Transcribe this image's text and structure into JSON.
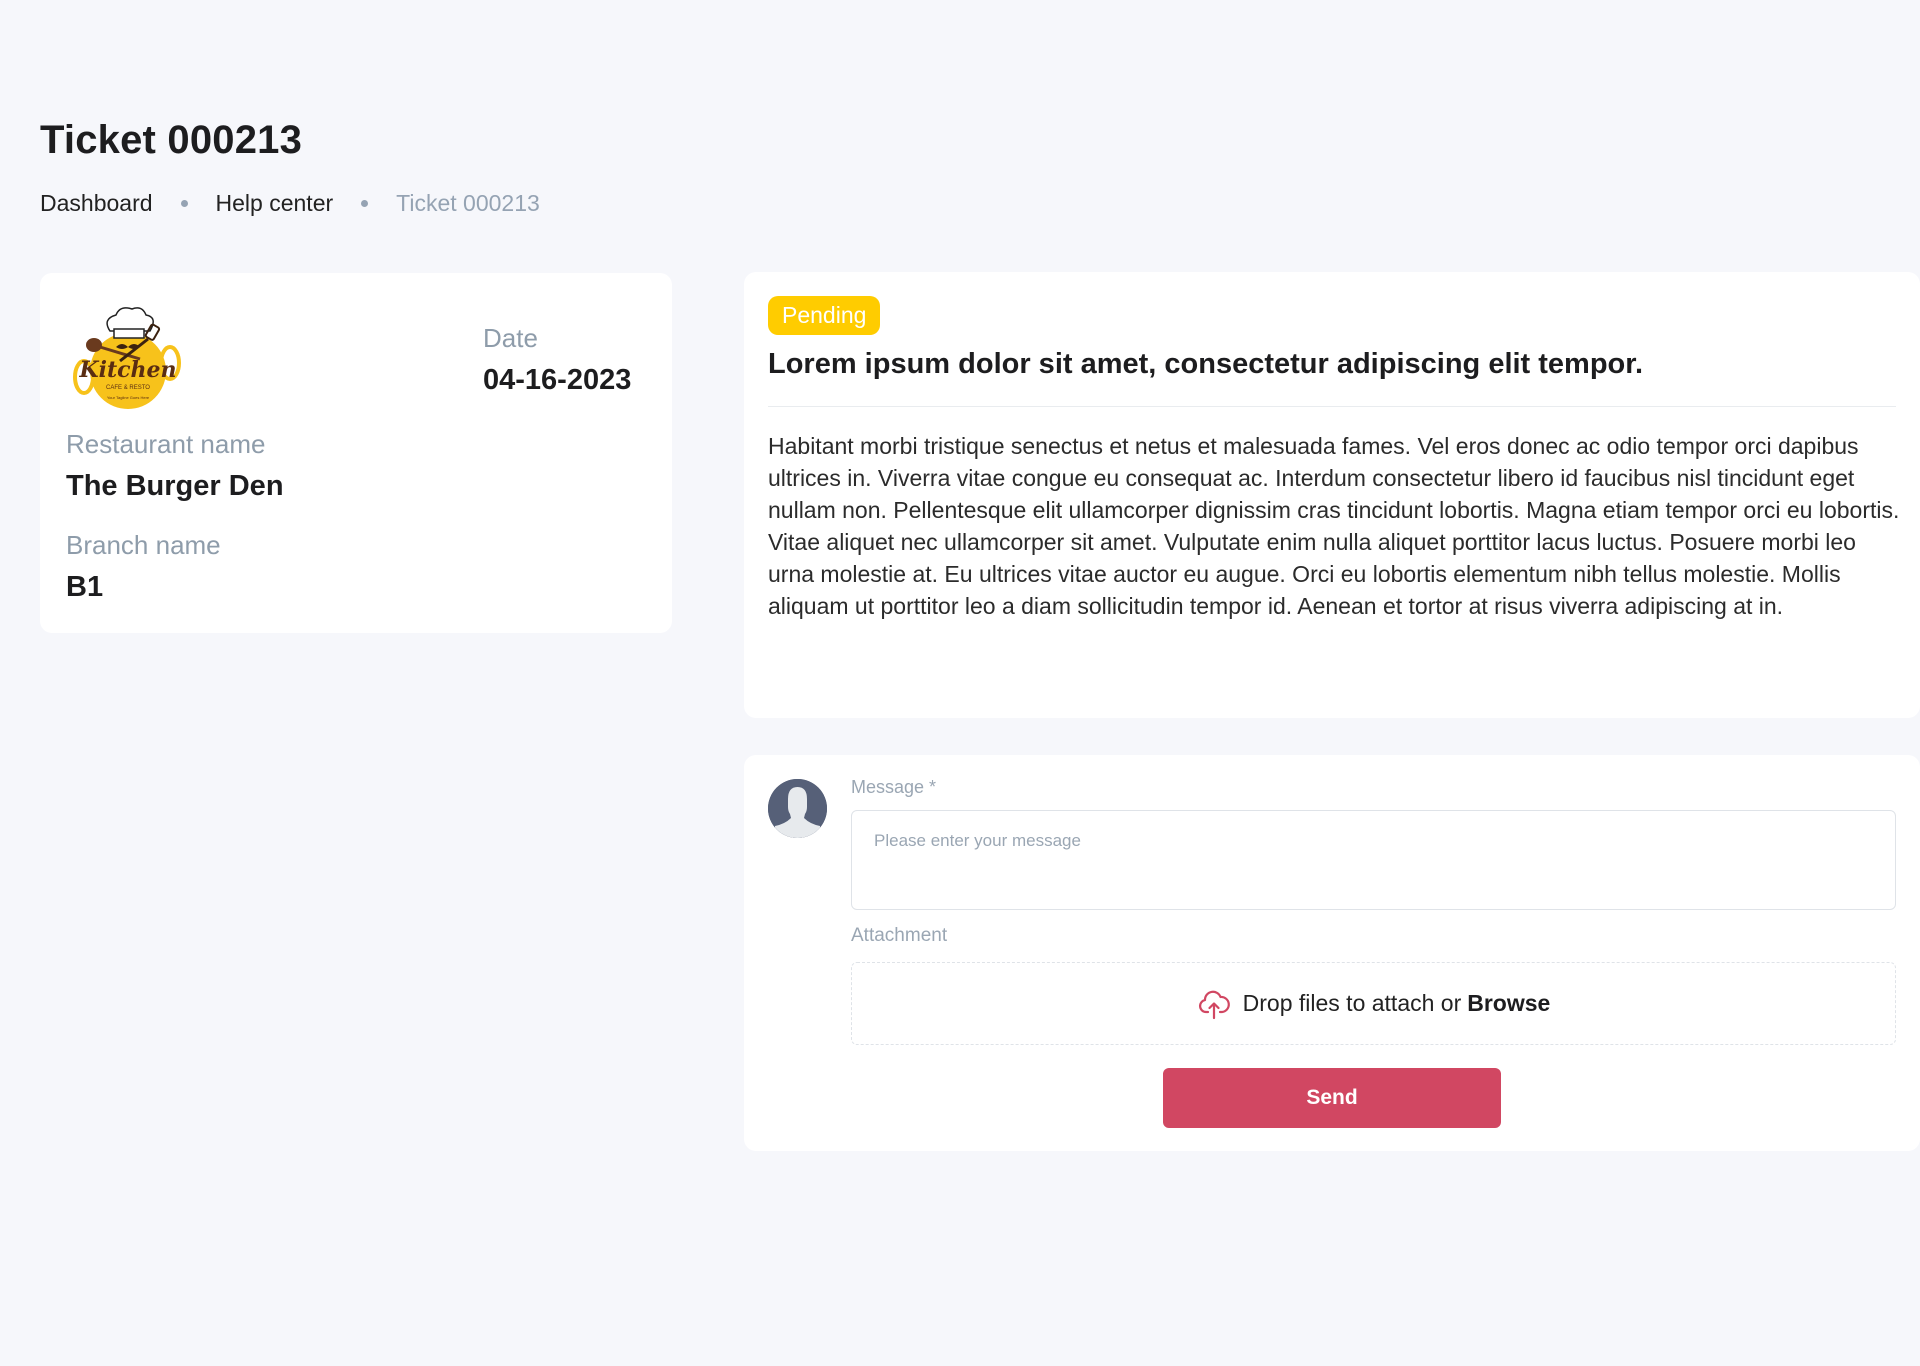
{
  "page": {
    "title": "Ticket 000213"
  },
  "breadcrumb": [
    {
      "label": "Dashboard"
    },
    {
      "label": "Help center"
    },
    {
      "label": "Ticket 000213"
    }
  ],
  "restaurant_card": {
    "logo": {
      "name": "Kitchen",
      "subtitle": "CAFE & RESTO",
      "tagline": "Your Tagline Goes Here"
    },
    "date_label": "Date",
    "date_value": "04-16-2023",
    "restaurant_label": "Restaurant name",
    "restaurant_value": "The Burger Den",
    "branch_label": "Branch name",
    "branch_value": "B1"
  },
  "ticket": {
    "status": "Pending",
    "status_color": "#FFCC00",
    "subject": "Lorem ipsum dolor sit amet, consectetur adipiscing elit tempor.",
    "body": "Habitant morbi tristique senectus et netus et malesuada fames. Vel eros donec ac odio tempor orci dapibus ultrices in. Viverra vitae congue eu consequat ac. Interdum consectetur libero id faucibus nisl tincidunt eget nullam non. Pellentesque elit ullamcorper dignissim cras tincidunt lobortis. Magna etiam tempor orci eu lobortis. Vitae aliquet nec ullamcorper sit amet. Vulputate enim nulla aliquet porttitor lacus luctus. Posuere morbi leo urna molestie at. Eu ultrices vitae auctor eu augue. Orci eu lobortis elementum nibh tellus molestie. Mollis aliquam ut porttitor leo a diam sollicitudin tempor id. Aenean et tortor at risus viverra adipiscing at in."
  },
  "reply": {
    "message_label": "Message *",
    "message_value": "",
    "message_placeholder": "Please enter your message",
    "attachment_label": "Attachment",
    "dropzone_text": "Drop files to attach or",
    "dropzone_link": "Browse",
    "send_label": "Send",
    "accent_color": "#D14762"
  }
}
